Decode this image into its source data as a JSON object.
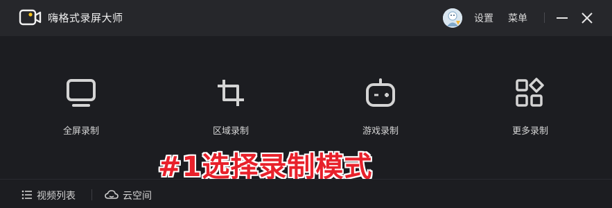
{
  "app": {
    "title": "嗨格式录屏大师"
  },
  "header": {
    "settings_label": "设置",
    "menu_label": "菜单"
  },
  "colors": {
    "background": "#1c1d21",
    "titlebar": "#26272b",
    "annotation": "#e8212b",
    "icon": "#d4d4d4"
  },
  "modes": [
    {
      "label": "全屏录制",
      "icon": "monitor-icon"
    },
    {
      "label": "区域录制",
      "icon": "crop-icon"
    },
    {
      "label": "游戏录制",
      "icon": "gamepad-icon"
    },
    {
      "label": "更多录制",
      "icon": "grid-icon"
    }
  ],
  "annotation": {
    "text": "#1选择录制模式"
  },
  "footer": {
    "video_list_label": "视频列表",
    "cloud_label": "云空间"
  }
}
